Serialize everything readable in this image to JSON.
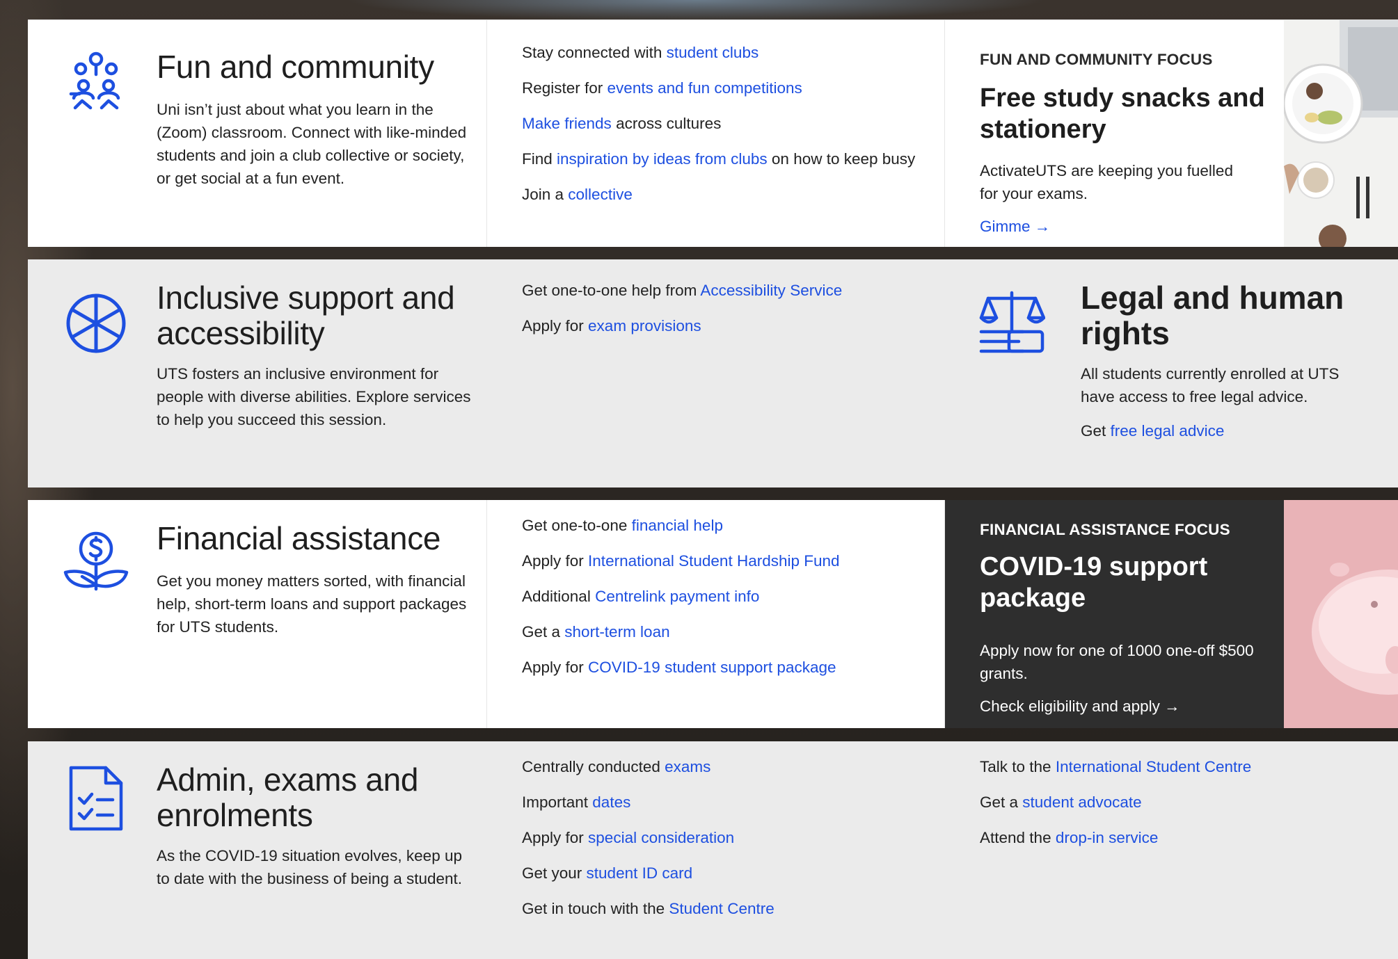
{
  "sections": [
    {
      "title": "Fun and community",
      "description": "Uni isn’t just about what you learn in the (Zoom) classroom. Connect with like-minded students and join a club collective or society, or get social at a fun event.",
      "icon": "community-people-icon",
      "links": [
        {
          "pre": "Stay connected with ",
          "link": "student clubs",
          "post": ""
        },
        {
          "pre": "Register for ",
          "link": "events and fun competitions",
          "post": ""
        },
        {
          "pre": "",
          "link": "Make friends",
          "post": " across cultures"
        },
        {
          "pre": "Find ",
          "link": "inspiration by ideas from clubs",
          "post": " on how to keep busy"
        },
        {
          "pre": "Join a ",
          "link": "collective",
          "post": ""
        }
      ],
      "focus": {
        "eyebrow": "FUN AND COMMUNITY FOCUS",
        "title": "Free study snacks and stationery",
        "description": "ActivateUTS are keeping you fuelled for your exams.",
        "cta": "Gimme →"
      }
    },
    {
      "title": "Inclusive support and accessibility",
      "description": "UTS fosters an inclusive environment for people with diverse abilities. Explore services to help you succeed this session.",
      "icon": "wheel-icon",
      "links": [
        {
          "pre": "Get one-to-one help from ",
          "link": "Accessibility Service",
          "post": ""
        },
        {
          "pre": "Apply for ",
          "link": "exam provisions",
          "post": ""
        }
      ],
      "legal": {
        "icon": "scales-of-justice-icon",
        "title": "Legal and human rights",
        "description": "All students currently enrolled at UTS have access to free legal advice.",
        "link_pre": "Get ",
        "link": "free legal advice"
      }
    },
    {
      "title": "Financial assistance",
      "description": "Get you money matters sorted, with financial help, short-term loans and support packages for UTS students.",
      "icon": "money-plant-icon",
      "links": [
        {
          "pre": "Get one-to-one ",
          "link": "financial help",
          "post": ""
        },
        {
          "pre": "Apply for ",
          "link": "International Student Hardship Fund",
          "post": ""
        },
        {
          "pre": "Additional ",
          "link": "Centrelink payment info",
          "post": ""
        },
        {
          "pre": "Get a ",
          "link": "short-term loan",
          "post": ""
        },
        {
          "pre": "Apply for ",
          "link": "COVID-19 student support package",
          "post": ""
        }
      ],
      "focus": {
        "eyebrow": "FINANCIAL ASSISTANCE FOCUS",
        "title": "COVID-19 support package",
        "description": "Apply now for one of 1000 one-off $500 grants.",
        "cta": "Check eligibility and apply →"
      }
    },
    {
      "title": "Admin, exams and enrolments",
      "description": "As the COVID-19 situation evolves, keep up to date with the business of being a student.",
      "icon": "checklist-icon",
      "links": [
        {
          "pre": "Centrally conducted ",
          "link": "exams",
          "post": ""
        },
        {
          "pre": "Important ",
          "link": "dates",
          "post": ""
        },
        {
          "pre": "Apply for ",
          "link": "special consideration",
          "post": ""
        },
        {
          "pre": "Get your ",
          "link": "student ID card",
          "post": ""
        },
        {
          "pre": "Get in touch with the ",
          "link": "Student Centre",
          "post": ""
        }
      ],
      "links_right": [
        {
          "pre": "Talk to the ",
          "link": "International Student Centre",
          "post": ""
        },
        {
          "pre": "Get a ",
          "link": "student advocate",
          "post": ""
        },
        {
          "pre": "Attend the ",
          "link": "drop-in service",
          "post": ""
        }
      ]
    }
  ],
  "colors": {
    "link": "#1d4fe0",
    "icon": "#1d4fe0",
    "grey_band": "#ebebeb",
    "dark_panel": "#2e2e2e"
  }
}
